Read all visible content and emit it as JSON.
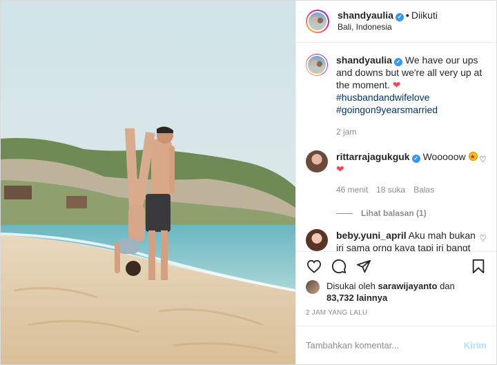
{
  "post": {
    "username": "shandyaulia",
    "follow_status": "Diikuti",
    "location": "Bali, Indonesia"
  },
  "caption": {
    "username": "shandyaulia",
    "text": "We have our ups and downs but we're all very up at the moment.",
    "hashtags": [
      "#husbandandwifelove",
      "#goingon9yearsmarried"
    ],
    "time": "2 jam"
  },
  "comments": [
    {
      "username": "rittarrajagukguk",
      "text": "Wooooow",
      "time": "46 menit",
      "likes": "18 suka",
      "reply": "Balas",
      "view_replies": "Lihat balasan (1)"
    },
    {
      "username": "beby.yuni_april",
      "text": "Aku mah bukan iri sama orng kaya tapi iri bangt sma yg udah punya anak tapi badan tetep bagus."
    }
  ],
  "likes": {
    "prefix": "Disukai oleh",
    "user": "sarawijayanto",
    "joiner": "dan",
    "count": "83,732 lainnya"
  },
  "timestamp": "2 JAM YANG LALU",
  "comment_box": {
    "placeholder": "Tambahkan komentar...",
    "post_label": "Kirim"
  },
  "icons": {
    "like": "heart-icon",
    "comment": "comment-icon",
    "share": "share-icon",
    "save": "bookmark-icon",
    "verified": "verified-badge-icon"
  },
  "colors": {
    "verified": "#3897f0",
    "hashtag": "#00376b",
    "muted": "#8e8e8e",
    "heart": "#ed4956",
    "post_button": "#b2dffc"
  }
}
